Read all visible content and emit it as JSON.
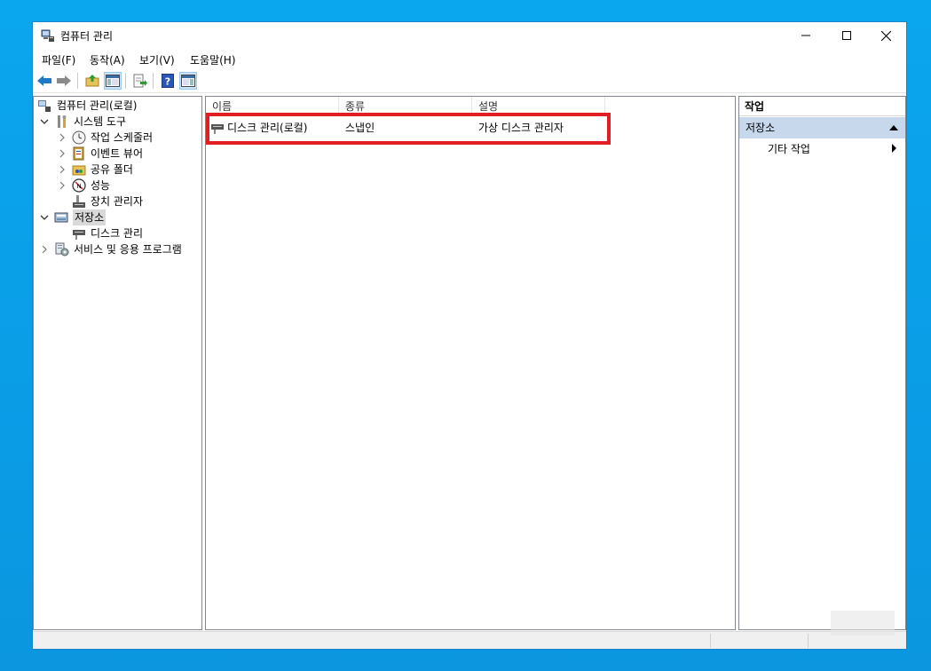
{
  "window": {
    "title": "컴퓨터 관리",
    "controls": {
      "minimize_icon": "minimize-icon",
      "maximize_icon": "maximize-icon",
      "close_icon": "close-icon"
    }
  },
  "menu": {
    "items": [
      "파일(F)",
      "동작(A)",
      "보기(V)",
      "도움말(H)"
    ]
  },
  "toolbar": {
    "buttons": [
      "back-arrow-icon",
      "forward-arrow-icon",
      "up-folder-icon",
      "show-console-tree-icon",
      "export-list-icon",
      "help-icon",
      "show-action-pane-icon"
    ]
  },
  "tree": {
    "root": "컴퓨터 관리(로컬)",
    "system_tools": "시스템 도구",
    "task_scheduler": "작업 스케줄러",
    "event_viewer": "이벤트 뷰어",
    "shared_folders": "공유 폴더",
    "performance": "성능",
    "device_manager": "장치 관리자",
    "storage": "저장소",
    "disk_management": "디스크 관리",
    "services_apps": "서비스 및 응용 프로그램"
  },
  "list": {
    "columns": [
      "이름",
      "종류",
      "설명"
    ],
    "rows": [
      {
        "name": "디스크 관리(로컬)",
        "type": "스냅인",
        "description": "가상 디스크 관리자"
      }
    ]
  },
  "actions": {
    "header": "작업",
    "section": "저장소",
    "more_actions": "기타 작업"
  },
  "colors": {
    "highlight_border": "#e01e24",
    "selection_bg": "#c7d8ec",
    "desktop": "#0aa6ee"
  }
}
